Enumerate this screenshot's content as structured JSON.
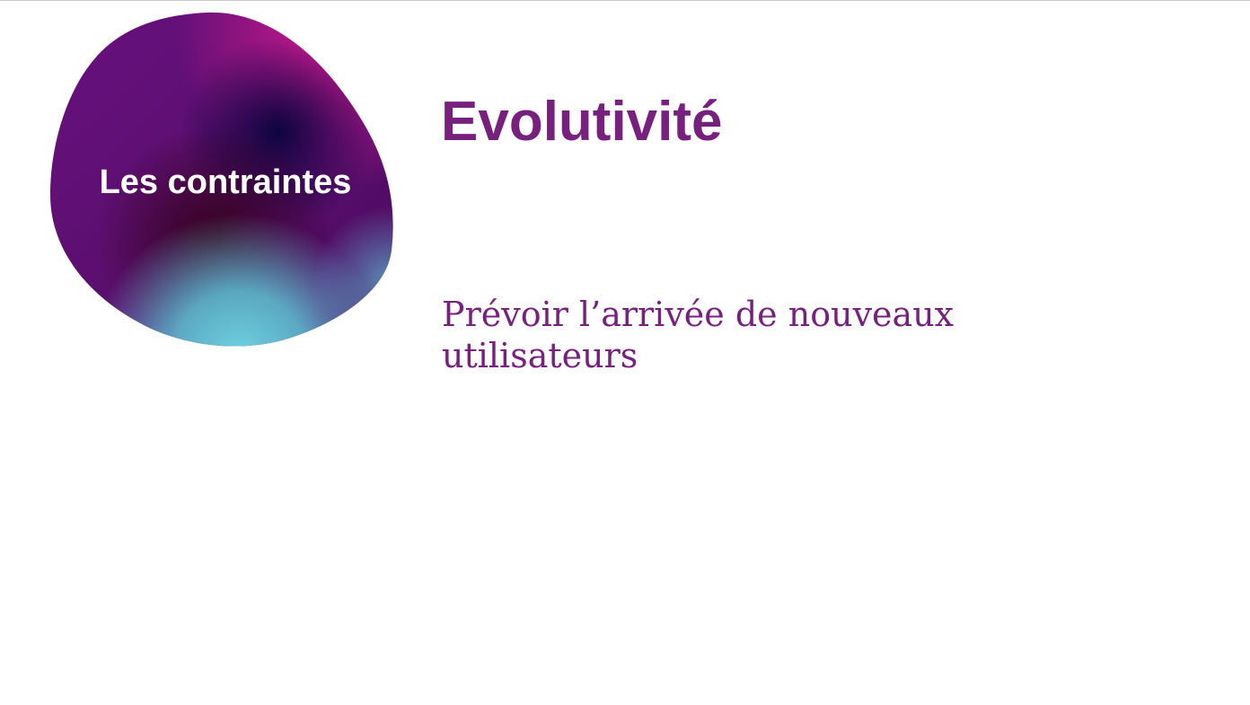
{
  "slide": {
    "badge_label": "Les contraintes",
    "title": "Evolutivité",
    "body": "Prévoir l’arrivée de nouveaux utilisateurs"
  },
  "colors": {
    "accent": "#77207e",
    "background": "#ffffff",
    "badge_text": "#ffffff",
    "blob_magenta": "#c2168f",
    "blob_purple": "#5a0f6e",
    "blob_navy": "#10053f",
    "blob_maroon": "#3a0218",
    "blob_cyan": "#5ec4d6"
  }
}
